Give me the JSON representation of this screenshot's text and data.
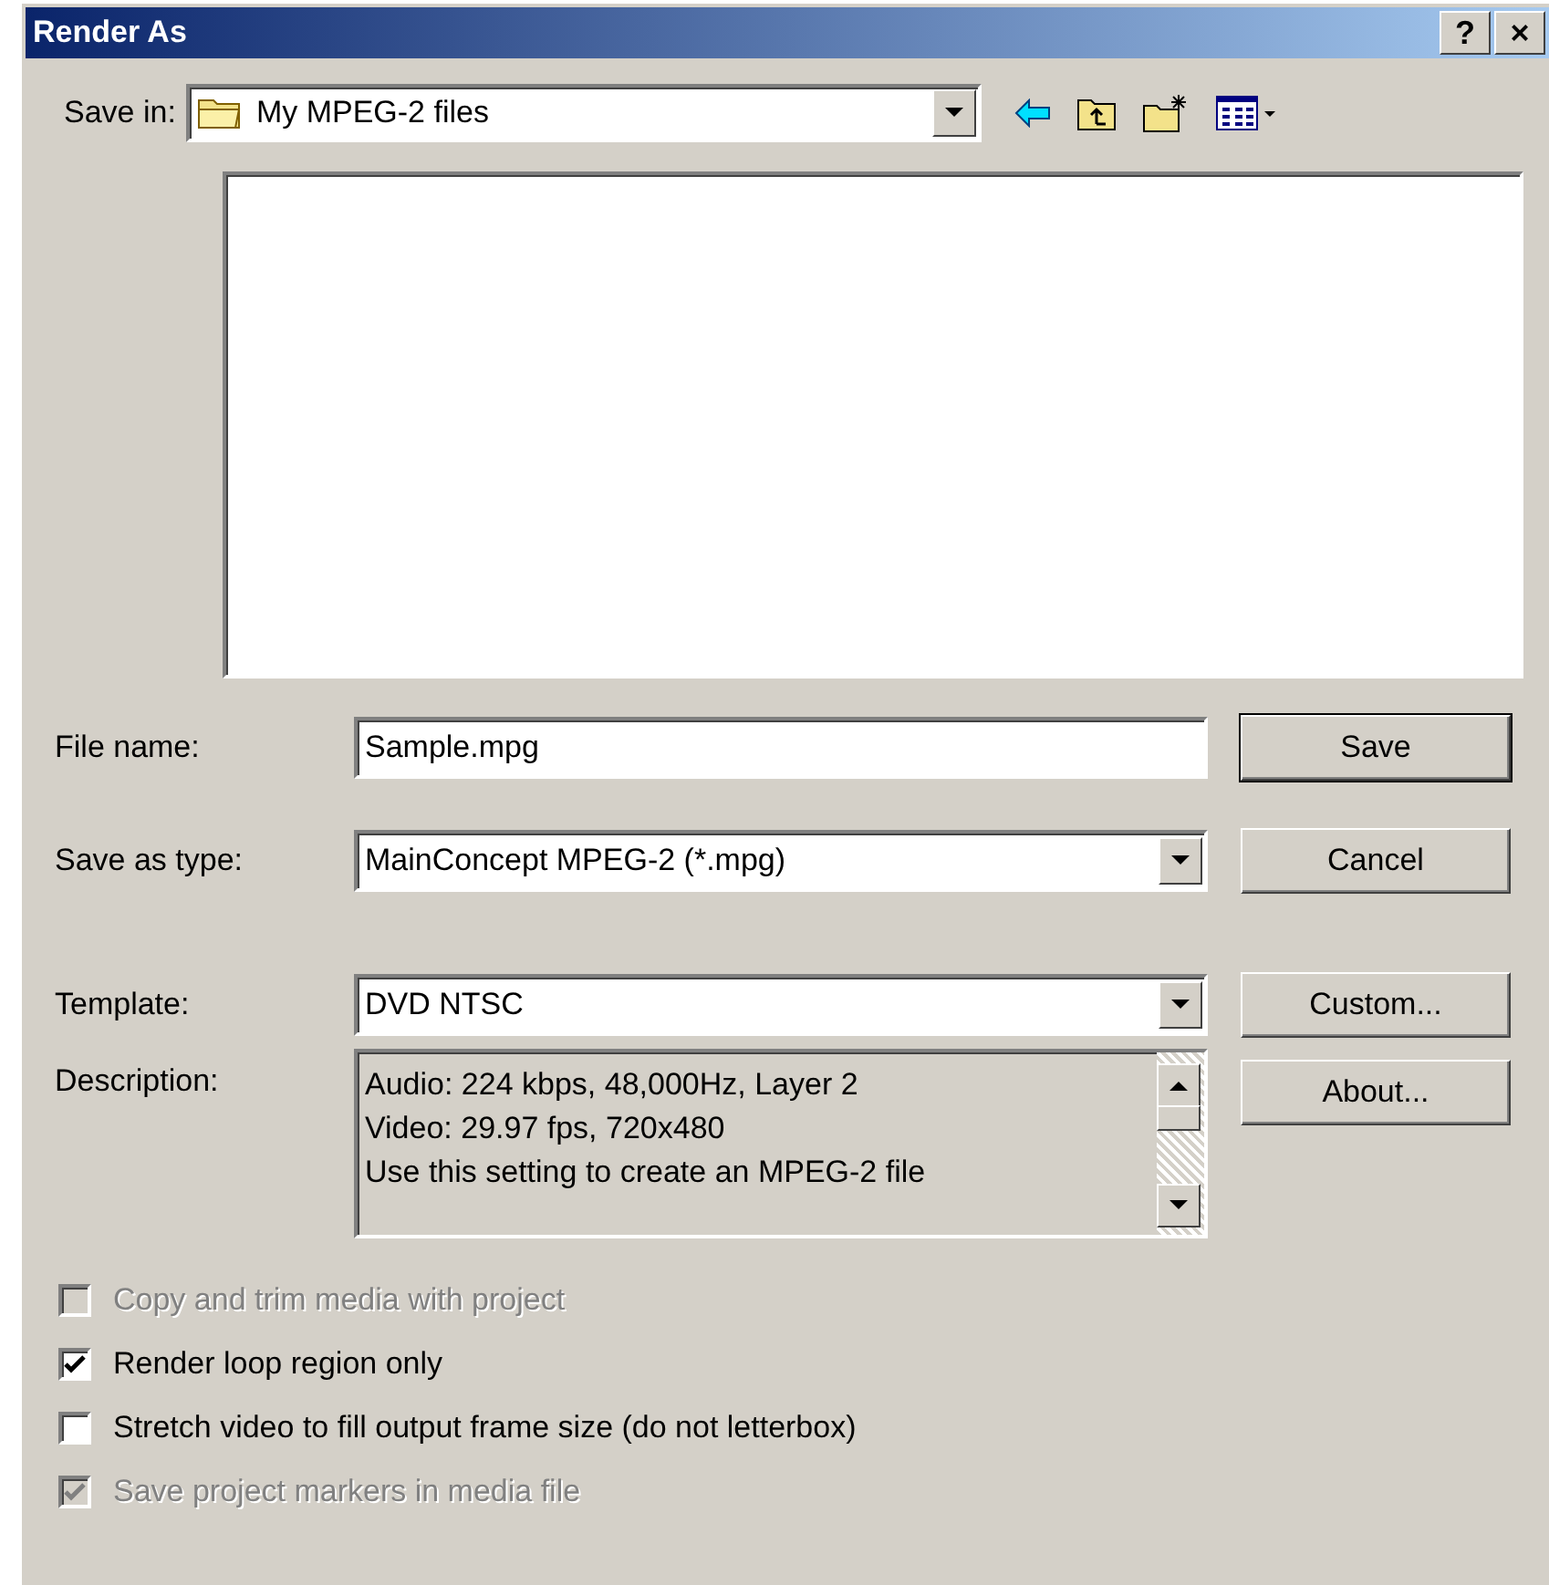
{
  "window": {
    "title": "Render As",
    "title_buttons": [
      "?",
      "×"
    ]
  },
  "save_in": {
    "label": "Save in:",
    "value": "My MPEG-2 files"
  },
  "file_name": {
    "label": "File name:",
    "value": "Sample.mpg"
  },
  "save_as_type": {
    "label": "Save as type:",
    "value": "MainConcept MPEG-2 (*.mpg)"
  },
  "template": {
    "label": "Template:",
    "value": "DVD NTSC"
  },
  "description": {
    "label": "Description:",
    "lines": [
      "Audio: 224 kbps, 48,000Hz, Layer 2",
      "Video: 29.97 fps, 720x480",
      "Use this setting to create an MPEG-2 file"
    ]
  },
  "buttons": [
    {
      "label": "Save",
      "default": true
    },
    {
      "label": "Cancel",
      "default": false
    },
    {
      "label": "Custom...",
      "default": false
    },
    {
      "label": "About...",
      "default": false
    }
  ],
  "options": [
    {
      "label": "Copy and trim media with project",
      "checked": false,
      "disabled": true
    },
    {
      "label": "Render loop region only",
      "checked": true,
      "disabled": false
    },
    {
      "label": "Stretch video to fill output frame size (do not letterbox)",
      "checked": false,
      "disabled": false
    },
    {
      "label": "Save project markers in media file",
      "checked": true,
      "disabled": true
    }
  ]
}
